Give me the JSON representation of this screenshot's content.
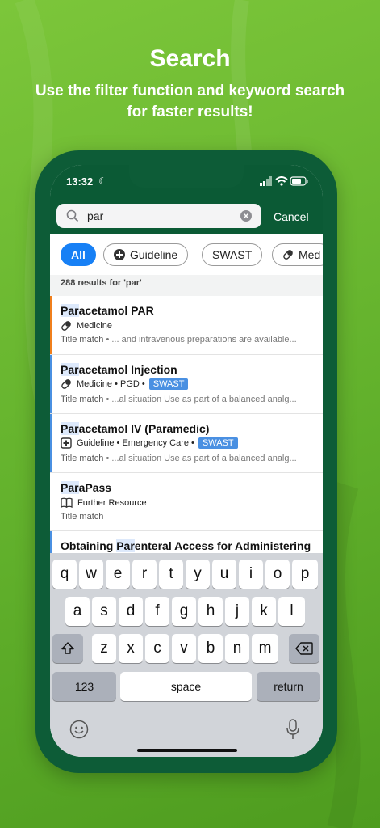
{
  "promo": {
    "title": "Search",
    "subtitle": "Use the filter function and keyword search for faster results!"
  },
  "status_bar": {
    "time": "13:32"
  },
  "search": {
    "value": "par",
    "cancel_label": "Cancel"
  },
  "filters": [
    {
      "label": "All",
      "active": true
    },
    {
      "label": "Guideline",
      "icon": "plus-circle-icon"
    },
    {
      "label": "SWAST"
    },
    {
      "label": "Med",
      "icon": "pill-icon"
    }
  ],
  "results_count": "288 results for 'par'",
  "results": [
    {
      "title_hl": "Par",
      "title_rest": "acetamol PAR",
      "meta_icon": "pill-icon",
      "meta": "Medicine",
      "tag": "",
      "match": "Title match",
      "snippet": "  •  ... and intravenous preparations are available...",
      "bar_color": "#f07f1c"
    },
    {
      "title_hl": "Par",
      "title_rest": "acetamol Injection",
      "meta_icon": "pill-icon",
      "meta": "Medicine • PGD •",
      "tag": "SWAST",
      "match": "Title match",
      "snippet": "  •  ...al situation Use as part of a balanced analg...",
      "bar_color": "#4a90e2"
    },
    {
      "title_hl": "Par",
      "title_rest": "acetamol IV (Paramedic)",
      "meta_icon": "plus-square-icon",
      "meta": "Guideline • Emergency Care •",
      "tag": "SWAST",
      "match": "Title match",
      "snippet": "  •  ...al situation Use as part of a balanced analg...",
      "bar_color": "#4a90e2"
    },
    {
      "title_hl": "Par",
      "title_rest": "aPass",
      "meta_icon": "book-icon",
      "meta": "Further Resource",
      "tag": "",
      "match": "Title match",
      "snippet": "",
      "bar_color": ""
    },
    {
      "title_pre": "Obtaining ",
      "title_hl": "Par",
      "title_rest": "enteral Access for Administering",
      "bar_color": "#4a90e2"
    }
  ],
  "keyboard": {
    "row1": [
      "q",
      "w",
      "e",
      "r",
      "t",
      "y",
      "u",
      "i",
      "o",
      "p"
    ],
    "row2": [
      "a",
      "s",
      "d",
      "f",
      "g",
      "h",
      "j",
      "k",
      "l"
    ],
    "row3": [
      "z",
      "x",
      "c",
      "v",
      "b",
      "n",
      "m"
    ],
    "numbers_label": "123",
    "space_label": "space",
    "return_label": "return"
  }
}
